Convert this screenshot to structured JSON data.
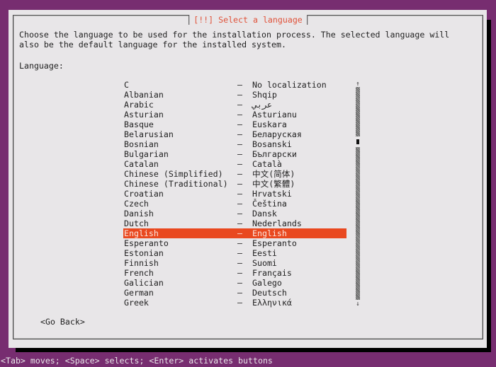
{
  "dialog": {
    "title": "[!!] Select a language",
    "description_line1": "Choose the language to be used for the installation process. The selected language will",
    "description_line2": "also be the default language for the installed system.",
    "language_label": "Language:",
    "selected_color": "#e9481f",
    "title_color": "#e0523a",
    "languages": [
      {
        "name": "C",
        "native": "No localization"
      },
      {
        "name": "Albanian",
        "native": "Shqip"
      },
      {
        "name": "Arabic",
        "native": "عربي"
      },
      {
        "name": "Asturian",
        "native": "Asturianu"
      },
      {
        "name": "Basque",
        "native": "Euskara"
      },
      {
        "name": "Belarusian",
        "native": "Беларуская"
      },
      {
        "name": "Bosnian",
        "native": "Bosanski"
      },
      {
        "name": "Bulgarian",
        "native": "Български"
      },
      {
        "name": "Catalan",
        "native": "Català"
      },
      {
        "name": "Chinese (Simplified)",
        "native": "中文(简体)"
      },
      {
        "name": "Chinese (Traditional)",
        "native": "中文(繁體)"
      },
      {
        "name": "Croatian",
        "native": "Hrvatski"
      },
      {
        "name": "Czech",
        "native": "Čeština"
      },
      {
        "name": "Danish",
        "native": "Dansk"
      },
      {
        "name": "Dutch",
        "native": "Nederlands"
      },
      {
        "name": "English",
        "native": "English",
        "selected": true
      },
      {
        "name": "Esperanto",
        "native": "Esperanto"
      },
      {
        "name": "Estonian",
        "native": "Eesti"
      },
      {
        "name": "Finnish",
        "native": "Suomi"
      },
      {
        "name": "French",
        "native": "Français"
      },
      {
        "name": "Galician",
        "native": "Galego"
      },
      {
        "name": "German",
        "native": "Deutsch"
      },
      {
        "name": "Greek",
        "native": "Ελληνικά"
      }
    ],
    "separator": "–",
    "scroll_up_icon": "↑",
    "scroll_down_icon": "↓",
    "go_back_label": "<Go Back>"
  },
  "status_bar": {
    "text": "<Tab> moves; <Space> selects; <Enter> activates buttons"
  }
}
